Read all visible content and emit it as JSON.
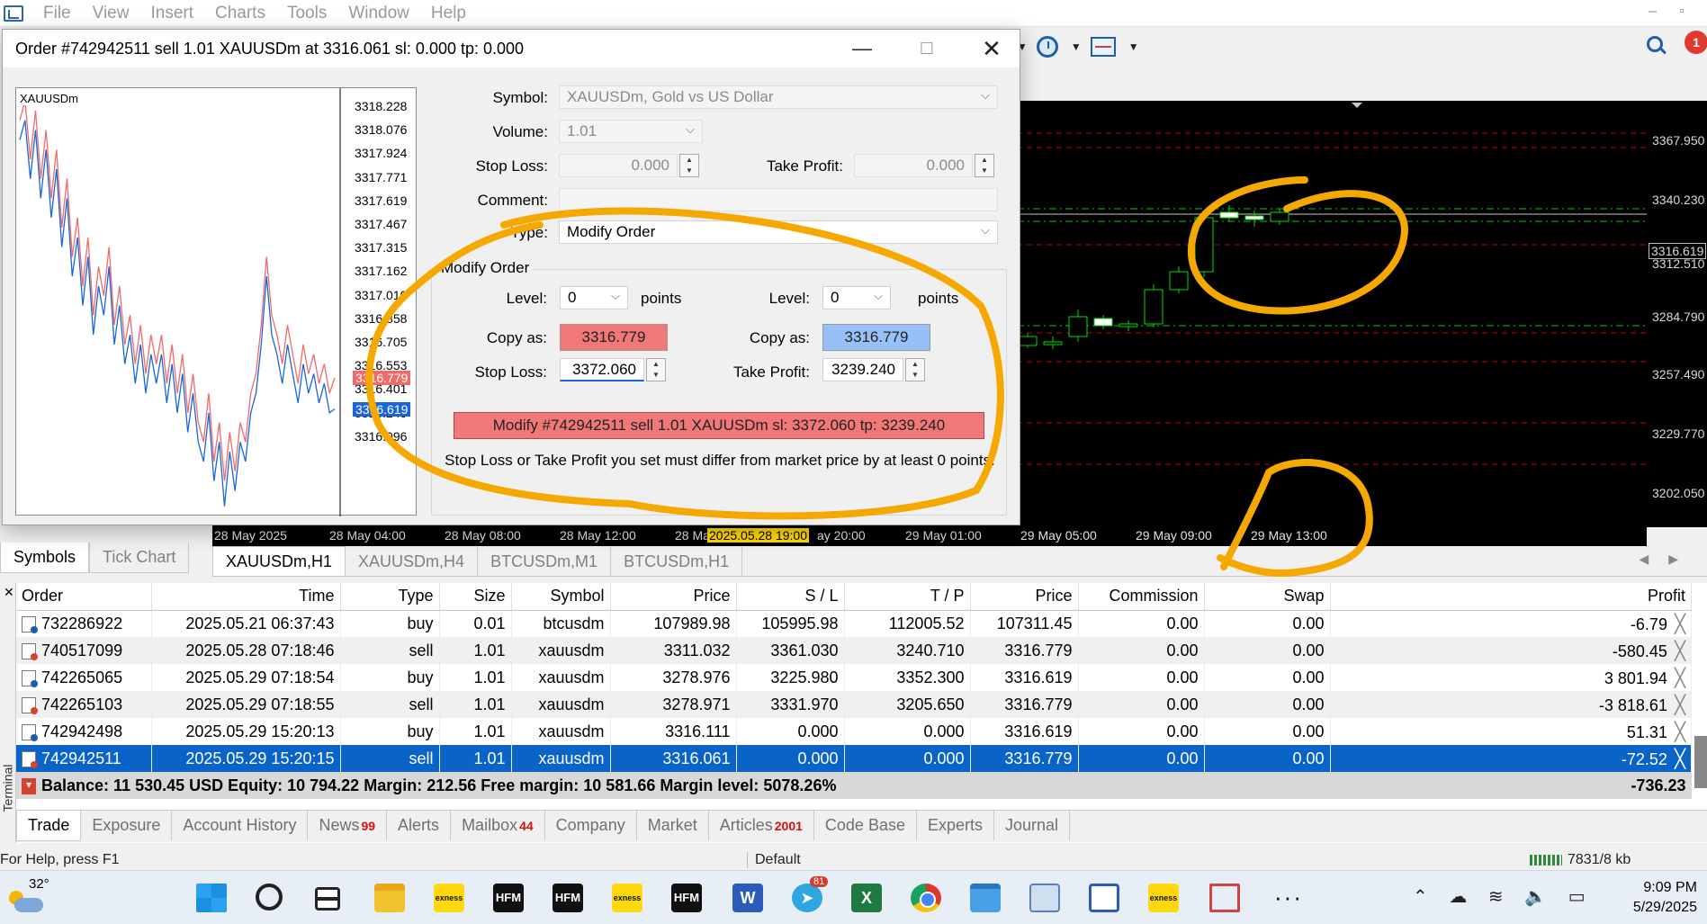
{
  "menu": {
    "items": [
      "File",
      "View",
      "Insert",
      "Charts",
      "Tools",
      "Window",
      "Help"
    ]
  },
  "toolbar": {
    "notification_count": "1"
  },
  "dialog": {
    "title": "Order #742942511 sell 1.01 XAUUSDm at 3316.061 sl: 0.000 tp: 0.000",
    "tick_chart": {
      "symbol": "XAUUSDm",
      "price_labels": [
        "3318.228",
        "3318.076",
        "3317.924",
        "3317.771",
        "3317.619",
        "3317.467",
        "3317.315",
        "3317.162",
        "3317.010",
        "3316.858",
        "3316.705",
        "3316.553",
        "3316.401",
        "3316.249",
        "3316.096"
      ],
      "ask_label": "3316.779",
      "bid_label": "3316.619",
      "ask_color": "#f06a6a",
      "bid_color": "#1a66d8",
      "series": [
        {
          "values": [
            3318.1,
            3318.2,
            3317.9,
            3318.15,
            3317.8,
            3318.05,
            3317.7,
            3317.95,
            3317.55,
            3317.8,
            3317.4,
            3317.6,
            3317.25,
            3317.5,
            3317.1,
            3317.35,
            3317.2,
            3317.45,
            3317.05,
            3317.25,
            3316.95,
            3317.1,
            3316.85,
            3317.05,
            3316.8,
            3317.0,
            3316.85,
            3317.0,
            3316.75,
            3316.95,
            3316.7,
            3316.9,
            3316.6,
            3316.8,
            3316.55,
            3316.45,
            3316.7,
            3316.35,
            3316.55,
            3316.25,
            3316.5,
            3316.3,
            3316.55,
            3316.45,
            3316.7,
            3316.8,
            3317.05,
            3317.4,
            3317.1,
            3317.0,
            3316.85,
            3317.05,
            3316.9,
            3316.75,
            3316.95,
            3316.8,
            3316.9,
            3316.75,
            3316.85,
            3316.7,
            3316.78
          ]
        },
        {
          "values": [
            3318.0,
            3318.1,
            3317.8,
            3318.05,
            3317.7,
            3317.95,
            3317.6,
            3317.85,
            3317.45,
            3317.7,
            3317.3,
            3317.5,
            3317.15,
            3317.4,
            3317.0,
            3317.25,
            3317.1,
            3317.35,
            3316.95,
            3317.15,
            3316.85,
            3317.0,
            3316.75,
            3316.95,
            3316.7,
            3316.9,
            3316.75,
            3316.9,
            3316.65,
            3316.85,
            3316.6,
            3316.8,
            3316.5,
            3316.7,
            3316.45,
            3316.35,
            3316.6,
            3316.25,
            3316.45,
            3316.12,
            3316.4,
            3316.2,
            3316.45,
            3316.35,
            3316.6,
            3316.7,
            3316.95,
            3317.3,
            3317.0,
            3316.9,
            3316.75,
            3316.95,
            3316.8,
            3316.65,
            3316.85,
            3316.7,
            3316.8,
            3316.65,
            3316.75,
            3316.6,
            3316.62
          ]
        }
      ],
      "ylim": [
        3316.096,
        3318.228
      ]
    },
    "form": {
      "symbol_label": "Symbol:",
      "symbol_value": "XAUUSDm, Gold vs US Dollar",
      "volume_label": "Volume:",
      "volume_value": "1.01",
      "stop_loss_label": "Stop Loss:",
      "stop_loss_value": "0.000",
      "take_profit_label": "Take Profit:",
      "take_profit_value": "0.000",
      "comment_label": "Comment:",
      "comment_value": "",
      "type_label": "Type:",
      "type_value": "Modify Order"
    },
    "modify": {
      "group_title": "Modify Order",
      "level_label": "Level:",
      "sl_level": "0",
      "tp_level": "0",
      "points_label": "points",
      "copy_as_label": "Copy as:",
      "sl_copy_value": "3316.779",
      "tp_copy_value": "3316.779",
      "stop_loss_label": "Stop Loss:",
      "stop_loss_value": "3372.060",
      "take_profit_label": "Take Profit:",
      "take_profit_value": "3239.240",
      "button_label": "Modify #742942511 sell 1.01 XAUUSDm sl: 3372.060 tp: 3239.240",
      "note": "Stop Loss or Take Profit you set must differ from market price by at least 0 points."
    }
  },
  "main_chart": {
    "price_labels": [
      "3367.950",
      "3340.230",
      "3312.510",
      "3284.790",
      "3257.490",
      "3229.770",
      "3202.050"
    ],
    "current_price": "3316.619",
    "time_labels": [
      "28 May 2025",
      "28 May 04:00",
      "28 May 08:00",
      "28 May 12:00",
      "28 Ma",
      "ay 20:00",
      "29 May 01:00",
      "29 May 05:00",
      "29 May 09:00",
      "29 May 13:00"
    ],
    "highlight_time": "2025.05.28 19:00",
    "candle_color": "#00dd00",
    "grid_red": "#cc0000",
    "grid_green": "#00cc00"
  },
  "market_watch_tabs": [
    "Symbols",
    "Tick Chart"
  ],
  "chart_tabs": [
    "XAUUSDm,H1",
    "XAUUSDm,H4",
    "BTCUSDm,M1",
    "BTCUSDm,H1"
  ],
  "terminal": {
    "side_label": "Terminal",
    "columns": [
      "Order",
      "Time",
      "Type",
      "Size",
      "Symbol",
      "Price",
      "S / L",
      "T / P",
      "Price",
      "Commission",
      "Swap",
      "Profit"
    ],
    "rows": [
      {
        "order": "732286922",
        "time": "2025.05.21 06:37:43",
        "type": "buy",
        "size": "0.01",
        "symbol": "btcusdm",
        "price": "107989.98",
        "sl": "105995.98",
        "tp": "112005.52",
        "cur": "107311.45",
        "commission": "0.00",
        "swap": "0.00",
        "profit": "-6.79"
      },
      {
        "order": "740517099",
        "time": "2025.05.28 07:18:46",
        "type": "sell",
        "size": "1.01",
        "symbol": "xauusdm",
        "price": "3311.032",
        "sl": "3361.030",
        "tp": "3240.710",
        "cur": "3316.779",
        "commission": "0.00",
        "swap": "0.00",
        "profit": "-580.45"
      },
      {
        "order": "742265065",
        "time": "2025.05.29 07:18:54",
        "type": "buy",
        "size": "1.01",
        "symbol": "xauusdm",
        "price": "3278.976",
        "sl": "3225.980",
        "tp": "3352.300",
        "cur": "3316.619",
        "commission": "0.00",
        "swap": "0.00",
        "profit": "3 801.94"
      },
      {
        "order": "742265103",
        "time": "2025.05.29 07:18:55",
        "type": "sell",
        "size": "1.01",
        "symbol": "xauusdm",
        "price": "3278.971",
        "sl": "3331.970",
        "tp": "3205.650",
        "cur": "3316.779",
        "commission": "0.00",
        "swap": "0.00",
        "profit": "-3 818.61"
      },
      {
        "order": "742942498",
        "time": "2025.05.29 15:20:13",
        "type": "buy",
        "size": "1.01",
        "symbol": "xauusdm",
        "price": "3316.111",
        "sl": "0.000",
        "tp": "0.000",
        "cur": "3316.619",
        "commission": "0.00",
        "swap": "0.00",
        "profit": "51.31"
      },
      {
        "order": "742942511",
        "time": "2025.05.29 15:20:15",
        "type": "sell",
        "size": "1.01",
        "symbol": "xauusdm",
        "price": "3316.061",
        "sl": "0.000",
        "tp": "0.000",
        "cur": "3316.779",
        "commission": "0.00",
        "swap": "0.00",
        "profit": "-72.52"
      }
    ],
    "summary": "Balance: 11 530.45 USD  Equity: 10 794.22  Margin: 212.56  Free margin: 10 581.66  Margin level: 5078.26%",
    "summary_profit": "-736.23",
    "tabs": [
      {
        "label": "Trade",
        "badge": ""
      },
      {
        "label": "Exposure",
        "badge": ""
      },
      {
        "label": "Account History",
        "badge": ""
      },
      {
        "label": "News",
        "badge": "99"
      },
      {
        "label": "Alerts",
        "badge": ""
      },
      {
        "label": "Mailbox",
        "badge": "44"
      },
      {
        "label": "Company",
        "badge": ""
      },
      {
        "label": "Market",
        "badge": ""
      },
      {
        "label": "Articles",
        "badge": "2001"
      },
      {
        "label": "Code Base",
        "badge": ""
      },
      {
        "label": "Experts",
        "badge": ""
      },
      {
        "label": "Journal",
        "badge": ""
      }
    ]
  },
  "statusbar": {
    "help": "For Help, press F1",
    "profile": "Default",
    "traffic": "7831/8 kb"
  },
  "taskbar": {
    "temperature": "32°",
    "telegram_badge": "81",
    "time": "9:09 PM",
    "date": "5/29/2025",
    "apps": [
      "exness",
      "HFM",
      "HFM",
      "exness",
      "HFM",
      "W",
      "X",
      "exness"
    ]
  },
  "annotation_color": "#f5a800"
}
